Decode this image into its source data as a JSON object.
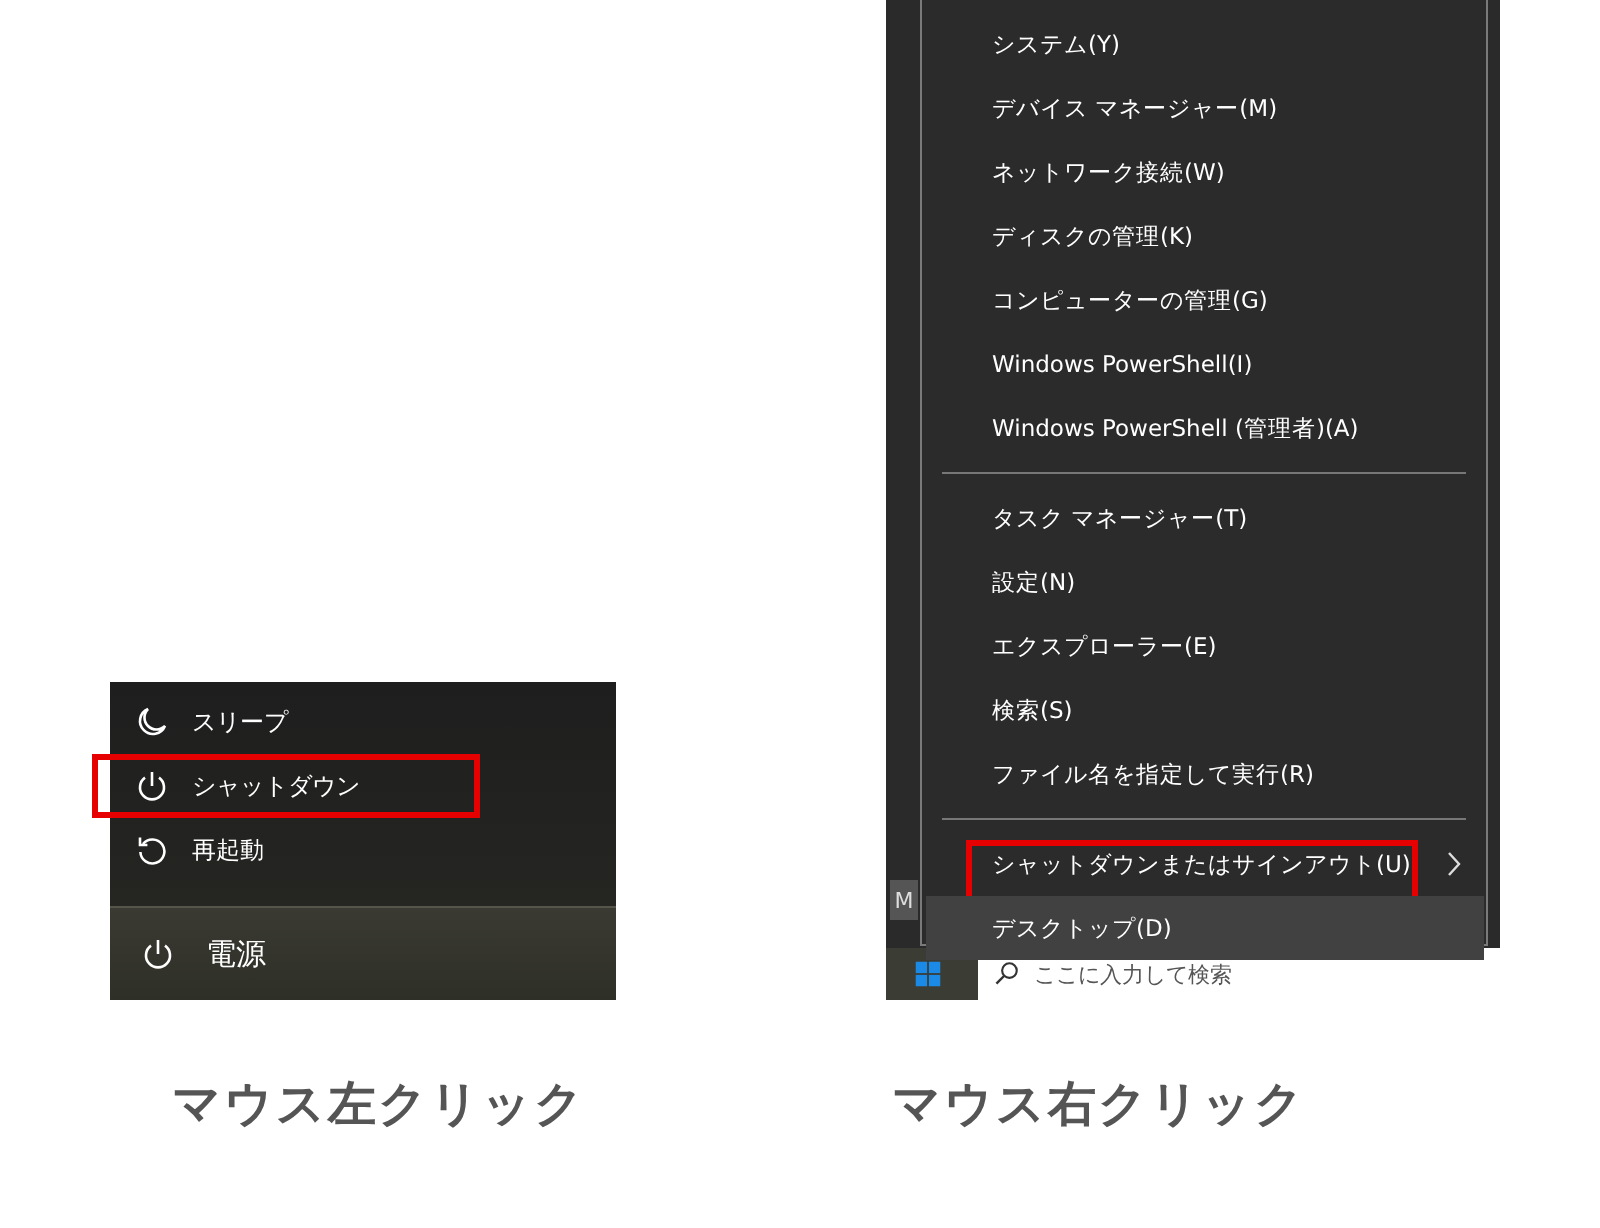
{
  "left_panel": {
    "items": [
      {
        "kind": "sleep",
        "label": "スリープ",
        "highlighted": false
      },
      {
        "kind": "shutdown",
        "label": "シャットダウン",
        "highlighted": true
      },
      {
        "kind": "restart",
        "label": "再起動",
        "highlighted": false
      }
    ],
    "power_button": {
      "label": "電源"
    },
    "caption": "マウス左クリック"
  },
  "right_panel": {
    "taskbar_tile": "M",
    "search": {
      "placeholder": "ここに入力して検索"
    },
    "menu": [
      [
        {
          "label": "システム(Y)",
          "selected": false,
          "highlighted": false,
          "submenu": false
        },
        {
          "label": "デバイス マネージャー(M)",
          "selected": false,
          "highlighted": false,
          "submenu": false
        },
        {
          "label": "ネットワーク接続(W)",
          "selected": false,
          "highlighted": false,
          "submenu": false
        },
        {
          "label": "ディスクの管理(K)",
          "selected": false,
          "highlighted": false,
          "submenu": false
        },
        {
          "label": "コンピューターの管理(G)",
          "selected": false,
          "highlighted": false,
          "submenu": false
        },
        {
          "label": "Windows PowerShell(I)",
          "selected": false,
          "highlighted": false,
          "submenu": false
        },
        {
          "label": "Windows PowerShell (管理者)(A)",
          "selected": false,
          "highlighted": false,
          "submenu": false
        }
      ],
      [
        {
          "label": "タスク マネージャー(T)",
          "selected": false,
          "highlighted": false,
          "submenu": false
        },
        {
          "label": "設定(N)",
          "selected": false,
          "highlighted": false,
          "submenu": false
        },
        {
          "label": "エクスプローラー(E)",
          "selected": false,
          "highlighted": false,
          "submenu": false
        },
        {
          "label": "検索(S)",
          "selected": false,
          "highlighted": false,
          "submenu": false
        },
        {
          "label": "ファイル名を指定して実行(R)",
          "selected": false,
          "highlighted": false,
          "submenu": false
        }
      ],
      [
        {
          "label": "シャットダウンまたはサインアウト(U)",
          "selected": false,
          "highlighted": true,
          "submenu": true
        },
        {
          "label": "デスクトップ(D)",
          "selected": true,
          "highlighted": false,
          "submenu": false
        }
      ]
    ],
    "caption": "マウス右クリック"
  }
}
